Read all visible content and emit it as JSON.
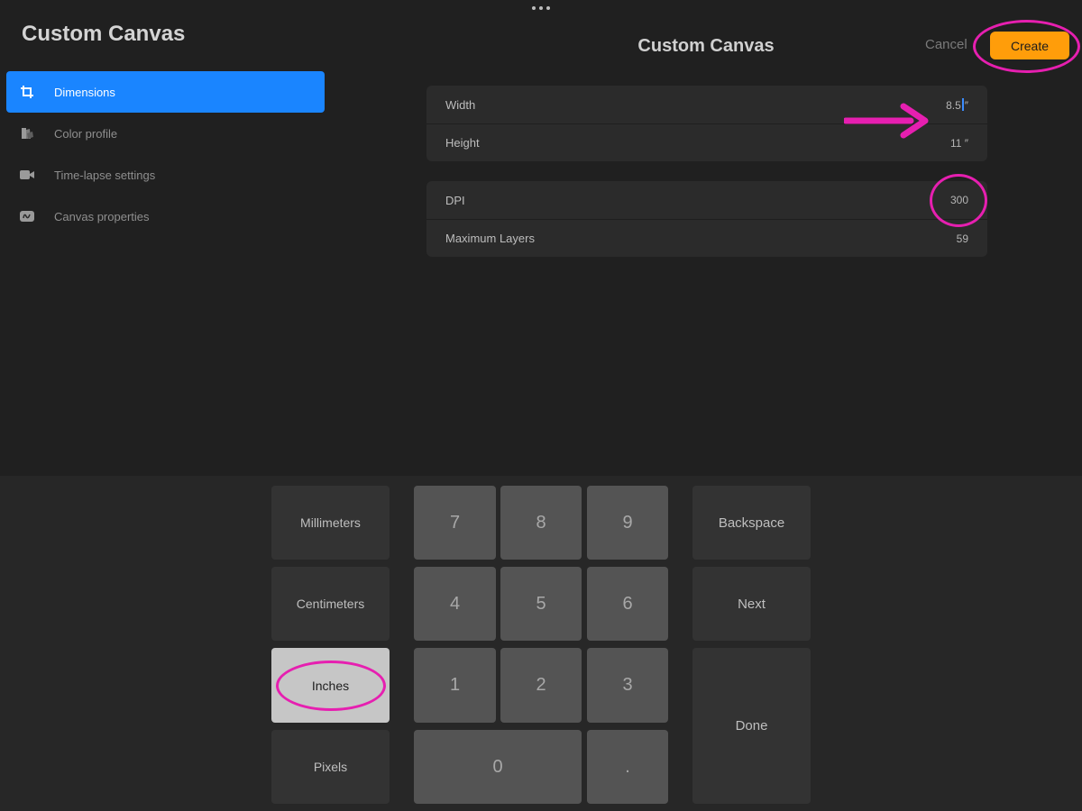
{
  "sidebar": {
    "title": "Custom Canvas",
    "items": [
      {
        "label": "Dimensions",
        "icon": "crop-icon",
        "active": true
      },
      {
        "label": "Color profile",
        "icon": "color-swatch-icon",
        "active": false
      },
      {
        "label": "Time-lapse settings",
        "icon": "video-camera-icon",
        "active": false
      },
      {
        "label": "Canvas properties",
        "icon": "canvas-properties-icon",
        "active": false
      }
    ]
  },
  "header": {
    "title": "Custom Canvas",
    "cancel_label": "Cancel",
    "create_label": "Create"
  },
  "dimensions": {
    "width_label": "Width",
    "width_value": "8.5",
    "width_unit": "″",
    "height_label": "Height",
    "height_value": "11 ″"
  },
  "settings": {
    "dpi_label": "DPI",
    "dpi_value": "300",
    "layers_label": "Maximum Layers",
    "layers_value": "59"
  },
  "keypad": {
    "units": [
      "Millimeters",
      "Centimeters",
      "Inches",
      "Pixels"
    ],
    "selected_unit": "Inches",
    "digits": [
      "7",
      "8",
      "9",
      "4",
      "5",
      "6",
      "1",
      "2",
      "3"
    ],
    "zero": "0",
    "dot": ".",
    "backspace_label": "Backspace",
    "next_label": "Next",
    "done_label": "Done"
  },
  "colors": {
    "accent_blue": "#1a85ff",
    "create_orange": "#ff9d0a",
    "annotation_magenta": "#e61fb0",
    "background": "#202020"
  }
}
